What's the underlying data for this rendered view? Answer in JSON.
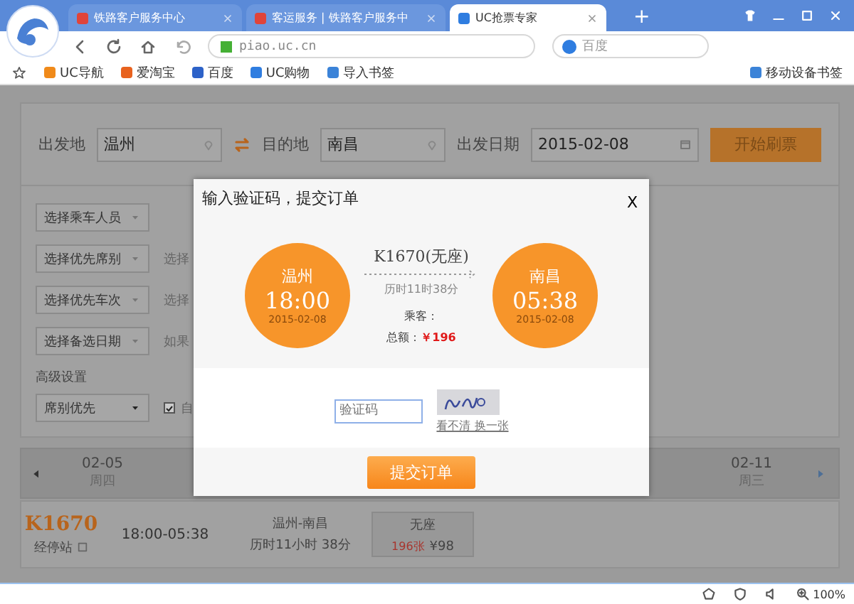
{
  "browser": {
    "tabs": [
      {
        "title": "铁路客户服务中心",
        "selected": false
      },
      {
        "title": "客运服务 | 铁路客户服务中",
        "selected": false
      },
      {
        "title": "UC抢票专家",
        "selected": true
      }
    ],
    "new_tab": "+",
    "address": "piao.uc.cn",
    "search_placeholder": "百度",
    "bookmarks": [
      "UC导航",
      "爱淘宝",
      "百度",
      "UC购物",
      "导入书签"
    ],
    "mobile_bookmarks": "移动设备书签"
  },
  "search_form": {
    "fields": [
      {
        "label": "出发地",
        "value": "温州",
        "kind": "place"
      },
      {
        "label": "目的地",
        "value": "南昌",
        "kind": "place"
      },
      {
        "label": "出发日期",
        "value": "2015-02-08",
        "kind": "date"
      }
    ],
    "button": "开始刷票"
  },
  "options": [
    {
      "dropdown": "选择乘车人员"
    },
    {
      "dropdown": "选择优先席别",
      "note": "选择"
    },
    {
      "dropdown": "选择优先车次",
      "note": "选择"
    },
    {
      "dropdown": "选择备选日期",
      "note": "如果"
    }
  ],
  "advanced": {
    "label": "高级设置",
    "dropdown": "席别优先",
    "checkbox": {
      "label": "自",
      "checked": true
    }
  },
  "date_strip": [
    {
      "date": "02-05",
      "weekday": "周四"
    },
    {
      "date": "02-11",
      "weekday": "周三"
    }
  ],
  "trains": [
    {
      "number": "K1670",
      "stops": "经停站",
      "time": "18:00-05:38",
      "route": "温州-南昌",
      "duration": "历时11小时 38分",
      "seat": "无座",
      "tickets": "196张",
      "price": "¥98"
    }
  ],
  "dialog": {
    "title": "输入验证码，提交订单",
    "close": "X",
    "from": {
      "city": "温州",
      "time": "18:00",
      "date": "2015-02-08"
    },
    "to": {
      "city": "南昌",
      "time": "05:38",
      "date": "2015-02-08"
    },
    "train": "K1670(无座)",
    "duration": "历时11时38分",
    "passenger_label": "乘客：",
    "total_label": "总额：",
    "total": "￥196",
    "captcha_placeholder": "验证码",
    "refresh_link": "看不清 换一张",
    "submit": "提交订单"
  },
  "status_bar": {
    "zoom": "100%"
  }
}
